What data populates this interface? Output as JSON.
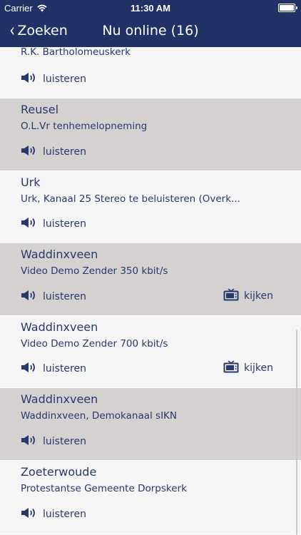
{
  "status_bar": {
    "carrier": "Carrier",
    "time": "11:30 AM"
  },
  "nav": {
    "back_label": "Zoeken",
    "title": "Nu online (16)"
  },
  "rows": [
    {
      "name": "",
      "desc": "R.K. Bartholomeuskerk",
      "listen": "luisteren",
      "watch": ""
    },
    {
      "name": "Reusel",
      "desc": "O.L.Vr tenhemelopneming",
      "listen": "luisteren",
      "watch": ""
    },
    {
      "name": "Urk",
      "desc": "Urk, Kanaal 25  Stereo te beluisteren (Overk...",
      "listen": "luisteren",
      "watch": ""
    },
    {
      "name": "Waddinxveen",
      "desc": "Video Demo Zender 350 kbit/s",
      "listen": "luisteren",
      "watch": "kijken"
    },
    {
      "name": "Waddinxveen",
      "desc": "Video Demo Zender 700 kbit/s",
      "listen": "luisteren",
      "watch": "kijken"
    },
    {
      "name": "Waddinxveen",
      "desc": "Waddinxveen, Demokanaal sIKN",
      "listen": "luisteren",
      "watch": ""
    },
    {
      "name": "Zoeterwoude",
      "desc": "Protestantse Gemeente Dorpskerk",
      "listen": "luisteren",
      "watch": ""
    }
  ],
  "colors": {
    "nav_bg": "#1f3165",
    "text": "#273a6b",
    "row_alt": "#d5d1d1",
    "row_bg": "#f6f5f6"
  }
}
